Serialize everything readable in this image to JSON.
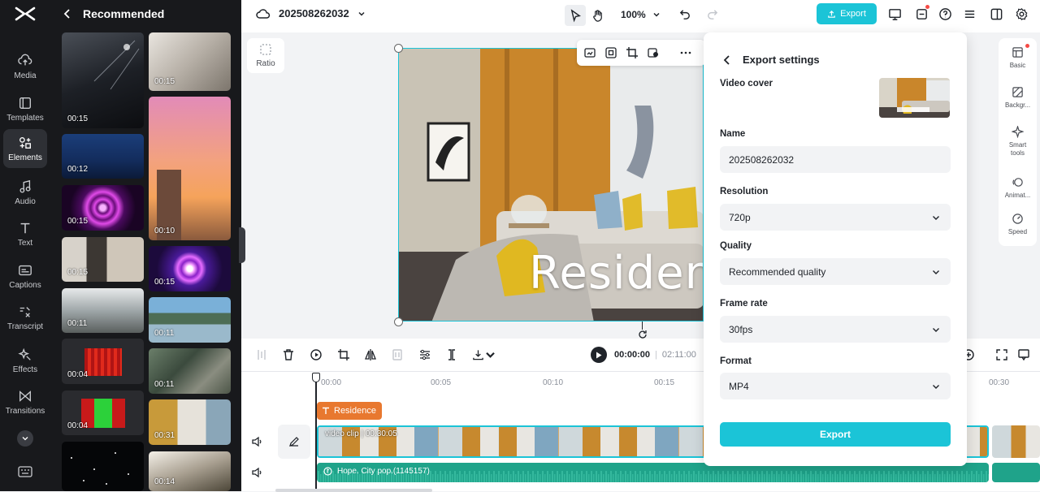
{
  "library": {
    "back_label": "Recommended",
    "thumbs_left": [
      {
        "duration": "00:15"
      },
      {
        "duration": "00:12"
      },
      {
        "duration": "00:15"
      },
      {
        "duration": "00:15"
      },
      {
        "duration": "00:11"
      },
      {
        "duration": "00:04"
      },
      {
        "duration": "00:04"
      },
      {
        "duration": ""
      }
    ],
    "thumbs_right": [
      {
        "duration": "00:15"
      },
      {
        "duration": "00:10"
      },
      {
        "duration": "00:15"
      },
      {
        "duration": "00:11"
      },
      {
        "duration": "00:11"
      },
      {
        "duration": "00:31"
      },
      {
        "duration": "00:14"
      }
    ]
  },
  "rail": {
    "items": [
      {
        "label": "Media",
        "icon": "cloud-upload-icon"
      },
      {
        "label": "Templates",
        "icon": "templates-icon"
      },
      {
        "label": "Elements",
        "icon": "elements-icon"
      },
      {
        "label": "Audio",
        "icon": "music-note-icon"
      },
      {
        "label": "Text",
        "icon": "text-icon"
      },
      {
        "label": "Captions",
        "icon": "captions-icon"
      },
      {
        "label": "Transcript",
        "icon": "transcript-icon"
      },
      {
        "label": "Effects",
        "icon": "effects-icon"
      },
      {
        "label": "Transitions",
        "icon": "transitions-icon"
      }
    ],
    "active": "Elements"
  },
  "topbar": {
    "project_name": "202508262032",
    "zoom": "100%",
    "export_label": "Export"
  },
  "canvas": {
    "ratio_label": "Ratio",
    "overlay_text": "Residen"
  },
  "side_panel": {
    "items": [
      {
        "label": "Basic"
      },
      {
        "label": "Backgr..."
      },
      {
        "label": "Smart tools"
      },
      {
        "label": "Animat..."
      },
      {
        "label": "Speed"
      }
    ]
  },
  "playback": {
    "current_time": "00:00:00",
    "separator": "|",
    "total_time": "02:11:00"
  },
  "timeline": {
    "ticks": [
      "00:00",
      "00:05",
      "00:10",
      "00:15",
      "00:30"
    ],
    "text_track": "Residence",
    "video_clip_label": "video clip",
    "video_clip_duration": "00:30:05",
    "audio_label": "Hope. City pop.(1145157)"
  },
  "export_panel": {
    "title": "Export settings",
    "cover_label": "Video cover",
    "name_label": "Name",
    "name_value": "202508262032",
    "resolution_label": "Resolution",
    "resolution_value": "720p",
    "quality_label": "Quality",
    "quality_value": "Recommended quality",
    "frame_rate_label": "Frame rate",
    "frame_rate_value": "30fps",
    "format_label": "Format",
    "format_value": "MP4",
    "export_button": "Export"
  },
  "colors": {
    "accent": "#1bc4d7",
    "text_track": "#e8782f",
    "audio_track": "#1fa38a",
    "dark_panel": "#18191c"
  }
}
